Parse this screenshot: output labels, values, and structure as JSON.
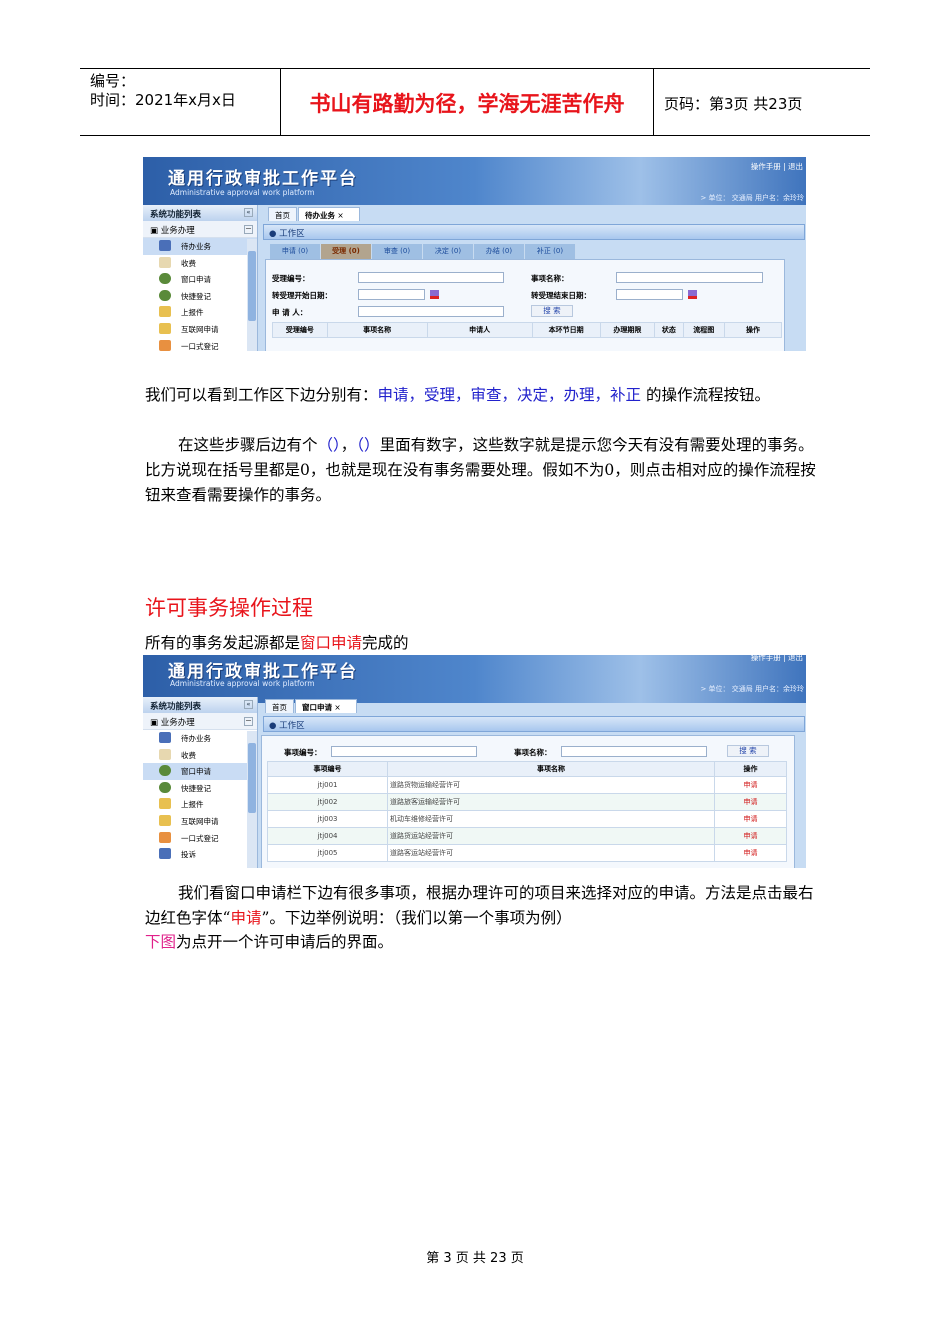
{
  "header": {
    "number_label": "编号：",
    "time_label": "时间：2021年x月x日",
    "motto": "书山有路勤为径，学海无涯苦作舟",
    "page_label": "页码：第3页 共23页"
  },
  "app": {
    "title": "通用行政审批工作平台",
    "subtitle": "Administrative approval work platform",
    "links": "操作手册 | 退出",
    "user": "> 单位： 交通局 用户名：余玲玲",
    "sidebar_title": "系统功能列表",
    "collapse": "«",
    "group": "业务办理",
    "group_toggle": "－",
    "items": [
      "待办业务",
      "收费",
      "窗口申请",
      "快捷登记",
      "上报件",
      "互联网申请",
      "一口式登记",
      "投诉"
    ],
    "tab_home": "首页",
    "close": "×",
    "workarea": "工作区",
    "search_btn": "搜 索"
  },
  "shot1": {
    "tab": "待办业务",
    "steps": [
      "申请 (0)",
      "受理 (0)",
      "审查 (0)",
      "决定 (0)",
      "办结 (0)",
      "补正 (0)"
    ],
    "labels": {
      "id": "受理编号：",
      "name": "事项名称：",
      "start": "转受理开始日期：",
      "end": "转受理结束日期：",
      "applicant": "申 请 人："
    },
    "columns": [
      "受理编号",
      "事项名称",
      "申请人",
      "本环节日期",
      "办理期限",
      "状态",
      "流程图",
      "操作"
    ]
  },
  "para1": {
    "prefix": "我们可以看到工作区下边分别有：",
    "steps": "申请，受理，审查，决定，办理，补正",
    "suffix": " 的操作流程按钮。"
  },
  "para2": {
    "a": "在这些步骤后边有个",
    "b": "（）",
    "c": "，",
    "d": "（）",
    "e": "里面有数字，这些数字就是提示您今天有没有需要处理的事务。比方说现在括号里都是0，也就是现在没有事务需要处理。假如不为0，则点击相对应的操作流程按钮来查看需要操作的事务。"
  },
  "section": {
    "heading": "许可事务操作过程",
    "intro_a": "所有的事务发起源都是",
    "intro_link": "窗口申请",
    "intro_b": "完成的"
  },
  "shot2": {
    "tab": "窗口申请",
    "labels": {
      "id": "事项编号：",
      "name": "事项名称："
    },
    "columns": [
      "事项编号",
      "事项名称",
      "操作"
    ],
    "rows": [
      {
        "id": "jtj001",
        "name": "道路货物运输经营许可",
        "op": "申请"
      },
      {
        "id": "jtj002",
        "name": "道路旅客运输经营许可",
        "op": "申请"
      },
      {
        "id": "jtj003",
        "name": "机动车维修经营许可",
        "op": "申请"
      },
      {
        "id": "jtj004",
        "name": "道路货运站经营许可",
        "op": "申请"
      },
      {
        "id": "jtj005",
        "name": "道路客运站经营许可",
        "op": "申请"
      }
    ]
  },
  "para3": {
    "a": "我们看窗口申请栏下边有很多事项，根据办理许可的项目来选择对应的申请。方法是点击最右边红色字体“",
    "b": "申请",
    "c": "”。下边举例说明：（我们以第一个事项为例）"
  },
  "para4": {
    "a": "下图",
    "b": "为点开一个许可申请后的界面。"
  },
  "footer": "第 3 页 共 23 页"
}
